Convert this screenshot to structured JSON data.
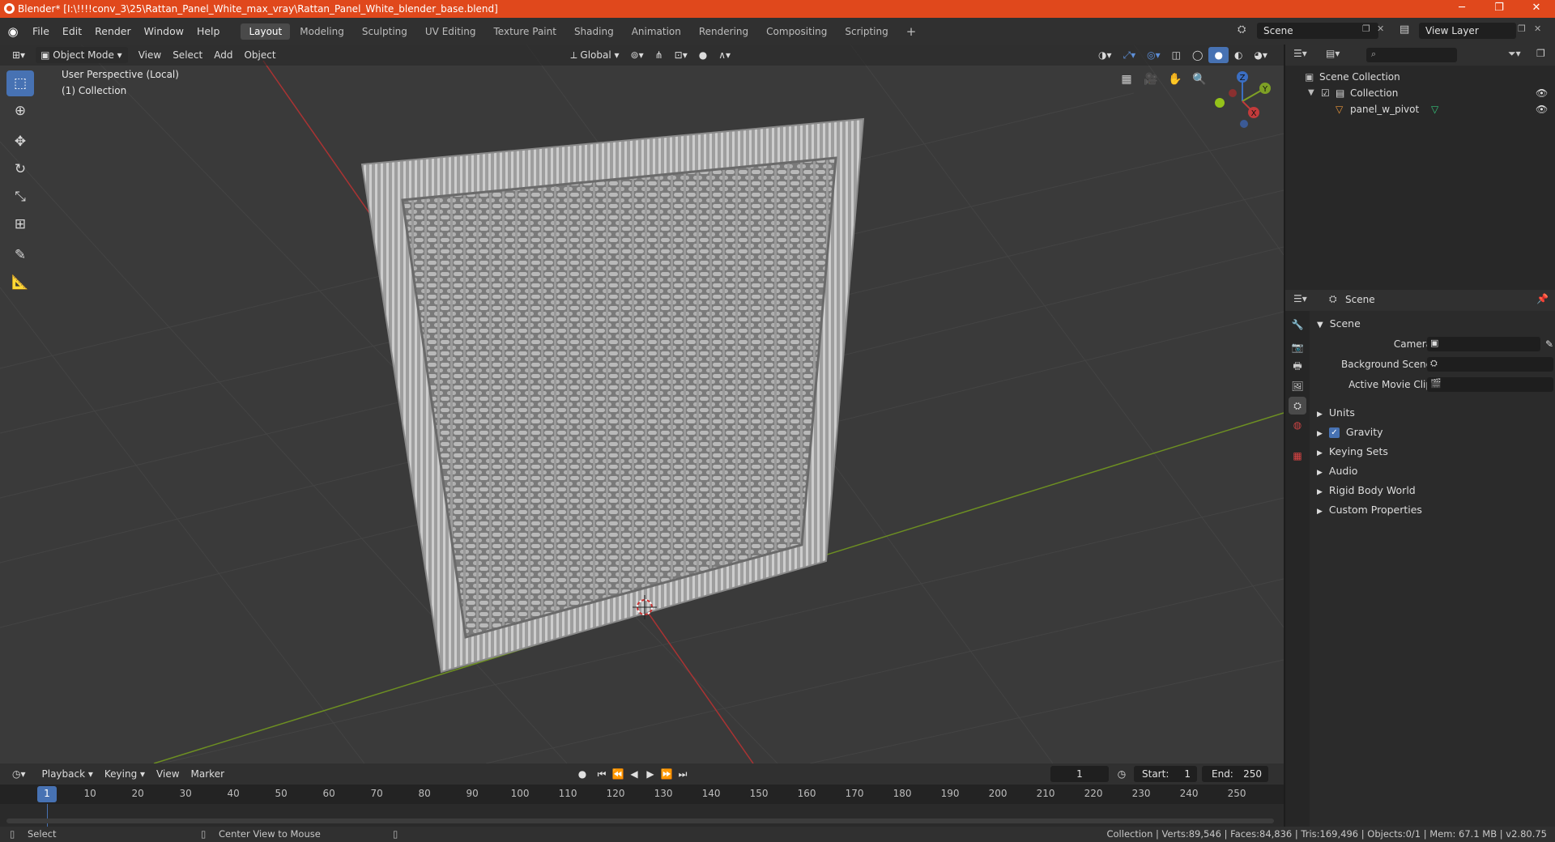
{
  "window": {
    "title": "Blender* [I:\\!!!!conv_3\\25\\Rattan_Panel_White_max_vray\\Rattan_Panel_White_blender_base.blend]",
    "minimize": "─",
    "maximize": "❐",
    "close": "✕"
  },
  "menu": [
    "File",
    "Edit",
    "Render",
    "Window",
    "Help"
  ],
  "workspaces": [
    "Layout",
    "Modeling",
    "Sculpting",
    "UV Editing",
    "Texture Paint",
    "Shading",
    "Animation",
    "Rendering",
    "Compositing",
    "Scripting"
  ],
  "workspace_add": "+",
  "scene_field": "Scene",
  "view_layer_field": "View Layer",
  "viewport": {
    "mode": "Object Mode",
    "menus": [
      "View",
      "Select",
      "Add",
      "Object"
    ],
    "orientation": "Global",
    "perspective_label": "User Perspective (Local)",
    "collection_label": "(1) Collection",
    "gizmo_axes": {
      "z": "Z",
      "y": "Y",
      "x": "X"
    }
  },
  "outliner": {
    "root": "Scene Collection",
    "collection": "Collection",
    "object": "panel_w_pivot"
  },
  "properties": {
    "header_title": "Scene",
    "section": "Scene",
    "camera_label": "Camera",
    "background_scene_label": "Background Scene",
    "active_movie_clip_label": "Active Movie Clip",
    "panels": [
      "Units",
      "Gravity",
      "Keying Sets",
      "Audio",
      "Rigid Body World",
      "Custom Properties"
    ],
    "gravity_checked": true
  },
  "timeline": {
    "menus": [
      "Playback",
      "Keying",
      "View",
      "Marker"
    ],
    "current_frame": "1",
    "start_label": "Start:",
    "start_value": "1",
    "end_label": "End:",
    "end_value": "250",
    "ruler_ticks": [
      "1",
      "10",
      "20",
      "30",
      "40",
      "50",
      "60",
      "70",
      "80",
      "90",
      "100",
      "110",
      "120",
      "130",
      "140",
      "150",
      "160",
      "170",
      "180",
      "190",
      "200",
      "210",
      "220",
      "230",
      "240",
      "250"
    ]
  },
  "statusbar": {
    "left_action": "Select",
    "middle_action": "Center View to Mouse",
    "stats": "Collection | Verts:89,546 | Faces:84,836 | Tris:169,496 | Objects:0/1 | Mem: 67.1 MB | v2.80.75"
  },
  "colors": {
    "title_bar": "#e0481c",
    "accent_active": "#4772b3",
    "axis_red": "#c23b3b",
    "axis_green": "#7ea025",
    "axis_blue": "#3b6ec2"
  }
}
